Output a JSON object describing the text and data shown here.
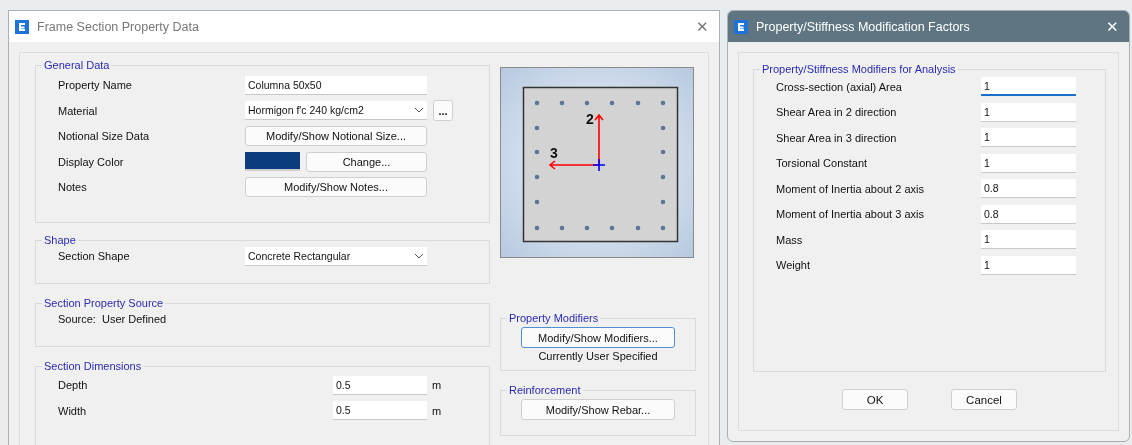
{
  "frame_dialog": {
    "title": "Frame Section Property Data",
    "general_data": {
      "title": "General Data",
      "fields": [
        {
          "kind": "text",
          "label": "Property Name",
          "value": "Columna 50x50"
        },
        {
          "kind": "dropdown",
          "label": "Material",
          "value": "Hormigon f'c 240 kg/cm2",
          "extra_button": "..."
        },
        {
          "kind": "button",
          "label": "Notional Size Data",
          "button": "Modify/Show Notional Size..."
        },
        {
          "kind": "color",
          "label": "Display Color",
          "color": "#0b3d7e",
          "button": "Change..."
        },
        {
          "kind": "button",
          "label": "Notes",
          "button": "Modify/Show Notes..."
        }
      ]
    },
    "shape": {
      "title": "Shape",
      "fields": [
        {
          "kind": "dropdown",
          "label": "Section Shape",
          "value": "Concrete Rectangular"
        }
      ]
    },
    "property_source": {
      "title": "Section Property Source",
      "text": "Source:  User Defined"
    },
    "dimensions": {
      "title": "Section Dimensions",
      "fields": [
        {
          "label": "Depth",
          "value": "0.5",
          "unit": "m"
        },
        {
          "label": "Width",
          "value": "0.5",
          "unit": "m"
        }
      ]
    },
    "preview": {
      "axis_labels": [
        "2",
        "3"
      ]
    },
    "property_modifiers": {
      "title": "Property Modifiers",
      "button": "Modify/Show Modifiers...",
      "focused": true,
      "status": "Currently User Specified"
    },
    "reinforcement": {
      "title": "Reinforcement",
      "button": "Modify/Show Rebar..."
    }
  },
  "modifiers_dialog": {
    "title": "Property/Stiffness Modification Factors",
    "close": "✕",
    "group_title": "Property/Stiffness Modifiers for Analysis",
    "rows": [
      {
        "label": "Cross-section (axial) Area",
        "value": "1",
        "focused": true
      },
      {
        "label": "Shear Area in 2 direction",
        "value": "1",
        "focused": false
      },
      {
        "label": "Shear Area in 3 direction",
        "value": "1",
        "focused": false
      },
      {
        "label": "Torsional Constant",
        "value": "1",
        "focused": false
      },
      {
        "label": "Moment of Inertia about 2 axis",
        "value": "0.8",
        "focused": false
      },
      {
        "label": "Moment of Inertia about 3 axis",
        "value": "0.8",
        "focused": false
      },
      {
        "label": "Mass",
        "value": "1",
        "focused": false
      },
      {
        "label": "Weight",
        "value": "1",
        "focused": false
      }
    ],
    "buttons": [
      "OK",
      "Cancel"
    ]
  },
  "frame_close": "✕"
}
